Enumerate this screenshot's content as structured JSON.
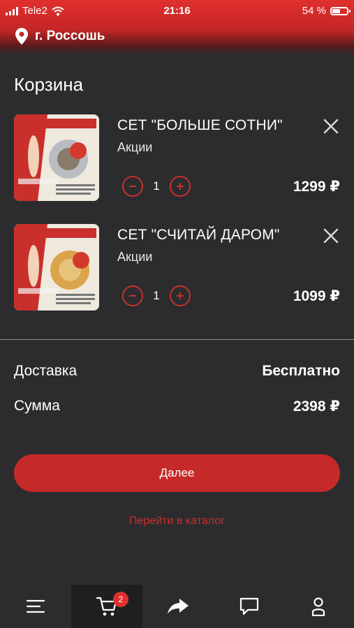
{
  "status_bar": {
    "carrier": "Tele2",
    "time": "21:16",
    "battery_percent": "54 %",
    "battery_level": 0.54
  },
  "header": {
    "location": "г. Россошь"
  },
  "cart": {
    "title": "Корзина",
    "items": [
      {
        "name": "СЕТ \"БОЛЬШЕ СОТНИ\"",
        "category": "Акции",
        "quantity": "1",
        "price": "1299 ₽"
      },
      {
        "name": "СЕТ \"СЧИТАЙ ДАРОМ\"",
        "category": "Акции",
        "quantity": "1",
        "price": "1099 ₽"
      }
    ],
    "delivery_label": "Доставка",
    "delivery_value": "Бесплатно",
    "sum_label": "Сумма",
    "sum_value": "2398 ₽",
    "next_button": "Далее",
    "catalog_link": "Перейти в каталог"
  },
  "tabbar": {
    "cart_badge": "2"
  },
  "colors": {
    "accent": "#c62a28",
    "background": "#2c2c2e"
  },
  "icons": [
    "location-pin-icon",
    "close-icon",
    "minus-icon",
    "plus-icon",
    "menu-icon",
    "cart-icon",
    "share-icon",
    "chat-icon",
    "profile-icon"
  ]
}
